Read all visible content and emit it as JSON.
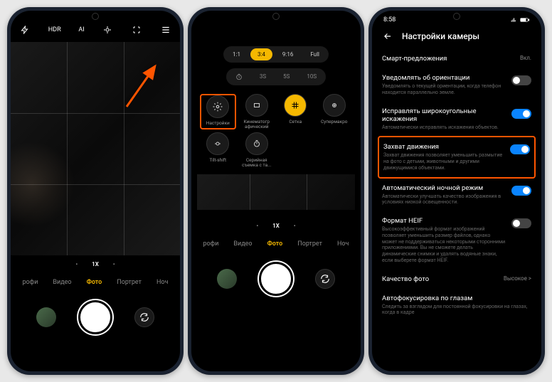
{
  "phone1": {
    "topbar": {
      "hdr": "HDR",
      "ai": "AI"
    },
    "zoom": {
      "wide": "•",
      "main": "1X",
      "tele": "•"
    },
    "modes": [
      "рофи",
      "Видео",
      "Фото",
      "Портрет",
      "Ноч"
    ],
    "active_mode_index": 2
  },
  "phone2": {
    "aspect": {
      "items": [
        "1:1",
        "3:4",
        "9:16",
        "Full"
      ],
      "active_index": 1
    },
    "timer": {
      "items": [
        "3S",
        "5S",
        "10S"
      ]
    },
    "tools": [
      {
        "label": "Настройки",
        "icon": "settings",
        "highlighted": true
      },
      {
        "label": "Кинематогр афический",
        "icon": "frame"
      },
      {
        "label": "Сетка",
        "icon": "grid",
        "active": true
      },
      {
        "label": "Супермакро",
        "icon": "macro"
      },
      {
        "label": "Tilt-shift",
        "icon": "tiltshift"
      },
      {
        "label": "Серийная съемка с та...",
        "icon": "burst"
      }
    ],
    "zoom": {
      "wide": "•",
      "main": "1X",
      "tele": "•"
    },
    "modes": [
      "рофи",
      "Видео",
      "Фото",
      "Портрет",
      "Ноч"
    ],
    "active_mode_index": 2
  },
  "phone3": {
    "statusbar": {
      "time": "8:58"
    },
    "header": {
      "title": "Настройки камеры"
    },
    "rows": [
      {
        "type": "simple",
        "label": "Смарт-предложения",
        "value": "Вкл."
      },
      {
        "type": "toggle",
        "label": "Уведомлять об ориентации",
        "desc": "Уведомлять о текущей ориентации, когда телефон находится параллельно земле.",
        "on": false
      },
      {
        "type": "toggle",
        "label": "Исправлять широкоугольные искажения",
        "desc": "Автоматически исправлять искажения объектов.",
        "on": true
      },
      {
        "type": "toggle",
        "label": "Захват движения",
        "desc": "Захват движения позволяет уменьшить размытие на фото с детьми, животными и другими движущимися объектами.",
        "on": true,
        "highlighted": true
      },
      {
        "type": "toggle",
        "label": "Автоматический ночной режим",
        "desc": "Автоматически улучшать качество изображения в условиях низкой освещенности.",
        "on": true
      },
      {
        "type": "toggle",
        "label": "Формат HEIF",
        "desc": "Высокоэффективный формат изображений позволяет уменьшить размер файлов, однако может не поддерживаться некоторыми сторонними приложениями. Вы не сможете делать динамические снимки и удалять водяные знаки, если выберете формат HEIF.",
        "on": false
      },
      {
        "type": "simple",
        "label": "Качество фото",
        "value": "Высокое >"
      },
      {
        "type": "toggle",
        "label": "Автофокусировка по глазам",
        "desc": "Следить за взглядом для постоянной фокусировки на глазах, когда в кадре",
        "on": false
      }
    ]
  }
}
